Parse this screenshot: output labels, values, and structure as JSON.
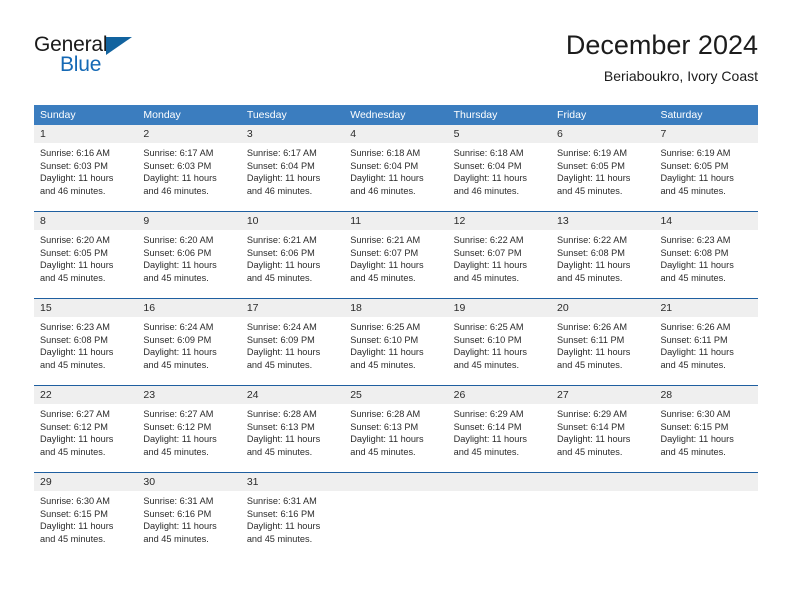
{
  "brand": {
    "name_part1": "General",
    "name_part2": "Blue",
    "accent_color": "#1569b5",
    "triangle_color": "#12639f"
  },
  "header": {
    "month_title": "December 2024",
    "location": "Beriaboukro, Ivory Coast"
  },
  "calendar": {
    "header_bg": "#3b7dbf",
    "row_divider_color": "#1f5fa0",
    "daynum_bg": "#efefef",
    "weekdays": [
      "Sunday",
      "Monday",
      "Tuesday",
      "Wednesday",
      "Thursday",
      "Friday",
      "Saturday"
    ],
    "weeks": [
      {
        "days": [
          {
            "num": "1",
            "sunrise": "Sunrise: 6:16 AM",
            "sunset": "Sunset: 6:03 PM",
            "daylight1": "Daylight: 11 hours",
            "daylight2": "and 46 minutes."
          },
          {
            "num": "2",
            "sunrise": "Sunrise: 6:17 AM",
            "sunset": "Sunset: 6:03 PM",
            "daylight1": "Daylight: 11 hours",
            "daylight2": "and 46 minutes."
          },
          {
            "num": "3",
            "sunrise": "Sunrise: 6:17 AM",
            "sunset": "Sunset: 6:04 PM",
            "daylight1": "Daylight: 11 hours",
            "daylight2": "and 46 minutes."
          },
          {
            "num": "4",
            "sunrise": "Sunrise: 6:18 AM",
            "sunset": "Sunset: 6:04 PM",
            "daylight1": "Daylight: 11 hours",
            "daylight2": "and 46 minutes."
          },
          {
            "num": "5",
            "sunrise": "Sunrise: 6:18 AM",
            "sunset": "Sunset: 6:04 PM",
            "daylight1": "Daylight: 11 hours",
            "daylight2": "and 46 minutes."
          },
          {
            "num": "6",
            "sunrise": "Sunrise: 6:19 AM",
            "sunset": "Sunset: 6:05 PM",
            "daylight1": "Daylight: 11 hours",
            "daylight2": "and 45 minutes."
          },
          {
            "num": "7",
            "sunrise": "Sunrise: 6:19 AM",
            "sunset": "Sunset: 6:05 PM",
            "daylight1": "Daylight: 11 hours",
            "daylight2": "and 45 minutes."
          }
        ]
      },
      {
        "days": [
          {
            "num": "8",
            "sunrise": "Sunrise: 6:20 AM",
            "sunset": "Sunset: 6:05 PM",
            "daylight1": "Daylight: 11 hours",
            "daylight2": "and 45 minutes."
          },
          {
            "num": "9",
            "sunrise": "Sunrise: 6:20 AM",
            "sunset": "Sunset: 6:06 PM",
            "daylight1": "Daylight: 11 hours",
            "daylight2": "and 45 minutes."
          },
          {
            "num": "10",
            "sunrise": "Sunrise: 6:21 AM",
            "sunset": "Sunset: 6:06 PM",
            "daylight1": "Daylight: 11 hours",
            "daylight2": "and 45 minutes."
          },
          {
            "num": "11",
            "sunrise": "Sunrise: 6:21 AM",
            "sunset": "Sunset: 6:07 PM",
            "daylight1": "Daylight: 11 hours",
            "daylight2": "and 45 minutes."
          },
          {
            "num": "12",
            "sunrise": "Sunrise: 6:22 AM",
            "sunset": "Sunset: 6:07 PM",
            "daylight1": "Daylight: 11 hours",
            "daylight2": "and 45 minutes."
          },
          {
            "num": "13",
            "sunrise": "Sunrise: 6:22 AM",
            "sunset": "Sunset: 6:08 PM",
            "daylight1": "Daylight: 11 hours",
            "daylight2": "and 45 minutes."
          },
          {
            "num": "14",
            "sunrise": "Sunrise: 6:23 AM",
            "sunset": "Sunset: 6:08 PM",
            "daylight1": "Daylight: 11 hours",
            "daylight2": "and 45 minutes."
          }
        ]
      },
      {
        "days": [
          {
            "num": "15",
            "sunrise": "Sunrise: 6:23 AM",
            "sunset": "Sunset: 6:08 PM",
            "daylight1": "Daylight: 11 hours",
            "daylight2": "and 45 minutes."
          },
          {
            "num": "16",
            "sunrise": "Sunrise: 6:24 AM",
            "sunset": "Sunset: 6:09 PM",
            "daylight1": "Daylight: 11 hours",
            "daylight2": "and 45 minutes."
          },
          {
            "num": "17",
            "sunrise": "Sunrise: 6:24 AM",
            "sunset": "Sunset: 6:09 PM",
            "daylight1": "Daylight: 11 hours",
            "daylight2": "and 45 minutes."
          },
          {
            "num": "18",
            "sunrise": "Sunrise: 6:25 AM",
            "sunset": "Sunset: 6:10 PM",
            "daylight1": "Daylight: 11 hours",
            "daylight2": "and 45 minutes."
          },
          {
            "num": "19",
            "sunrise": "Sunrise: 6:25 AM",
            "sunset": "Sunset: 6:10 PM",
            "daylight1": "Daylight: 11 hours",
            "daylight2": "and 45 minutes."
          },
          {
            "num": "20",
            "sunrise": "Sunrise: 6:26 AM",
            "sunset": "Sunset: 6:11 PM",
            "daylight1": "Daylight: 11 hours",
            "daylight2": "and 45 minutes."
          },
          {
            "num": "21",
            "sunrise": "Sunrise: 6:26 AM",
            "sunset": "Sunset: 6:11 PM",
            "daylight1": "Daylight: 11 hours",
            "daylight2": "and 45 minutes."
          }
        ]
      },
      {
        "days": [
          {
            "num": "22",
            "sunrise": "Sunrise: 6:27 AM",
            "sunset": "Sunset: 6:12 PM",
            "daylight1": "Daylight: 11 hours",
            "daylight2": "and 45 minutes."
          },
          {
            "num": "23",
            "sunrise": "Sunrise: 6:27 AM",
            "sunset": "Sunset: 6:12 PM",
            "daylight1": "Daylight: 11 hours",
            "daylight2": "and 45 minutes."
          },
          {
            "num": "24",
            "sunrise": "Sunrise: 6:28 AM",
            "sunset": "Sunset: 6:13 PM",
            "daylight1": "Daylight: 11 hours",
            "daylight2": "and 45 minutes."
          },
          {
            "num": "25",
            "sunrise": "Sunrise: 6:28 AM",
            "sunset": "Sunset: 6:13 PM",
            "daylight1": "Daylight: 11 hours",
            "daylight2": "and 45 minutes."
          },
          {
            "num": "26",
            "sunrise": "Sunrise: 6:29 AM",
            "sunset": "Sunset: 6:14 PM",
            "daylight1": "Daylight: 11 hours",
            "daylight2": "and 45 minutes."
          },
          {
            "num": "27",
            "sunrise": "Sunrise: 6:29 AM",
            "sunset": "Sunset: 6:14 PM",
            "daylight1": "Daylight: 11 hours",
            "daylight2": "and 45 minutes."
          },
          {
            "num": "28",
            "sunrise": "Sunrise: 6:30 AM",
            "sunset": "Sunset: 6:15 PM",
            "daylight1": "Daylight: 11 hours",
            "daylight2": "and 45 minutes."
          }
        ]
      },
      {
        "days": [
          {
            "num": "29",
            "sunrise": "Sunrise: 6:30 AM",
            "sunset": "Sunset: 6:15 PM",
            "daylight1": "Daylight: 11 hours",
            "daylight2": "and 45 minutes."
          },
          {
            "num": "30",
            "sunrise": "Sunrise: 6:31 AM",
            "sunset": "Sunset: 6:16 PM",
            "daylight1": "Daylight: 11 hours",
            "daylight2": "and 45 minutes."
          },
          {
            "num": "31",
            "sunrise": "Sunrise: 6:31 AM",
            "sunset": "Sunset: 6:16 PM",
            "daylight1": "Daylight: 11 hours",
            "daylight2": "and 45 minutes."
          },
          {
            "num": "",
            "sunrise": "",
            "sunset": "",
            "daylight1": "",
            "daylight2": ""
          },
          {
            "num": "",
            "sunrise": "",
            "sunset": "",
            "daylight1": "",
            "daylight2": ""
          },
          {
            "num": "",
            "sunrise": "",
            "sunset": "",
            "daylight1": "",
            "daylight2": ""
          },
          {
            "num": "",
            "sunrise": "",
            "sunset": "",
            "daylight1": "",
            "daylight2": ""
          }
        ]
      }
    ]
  }
}
